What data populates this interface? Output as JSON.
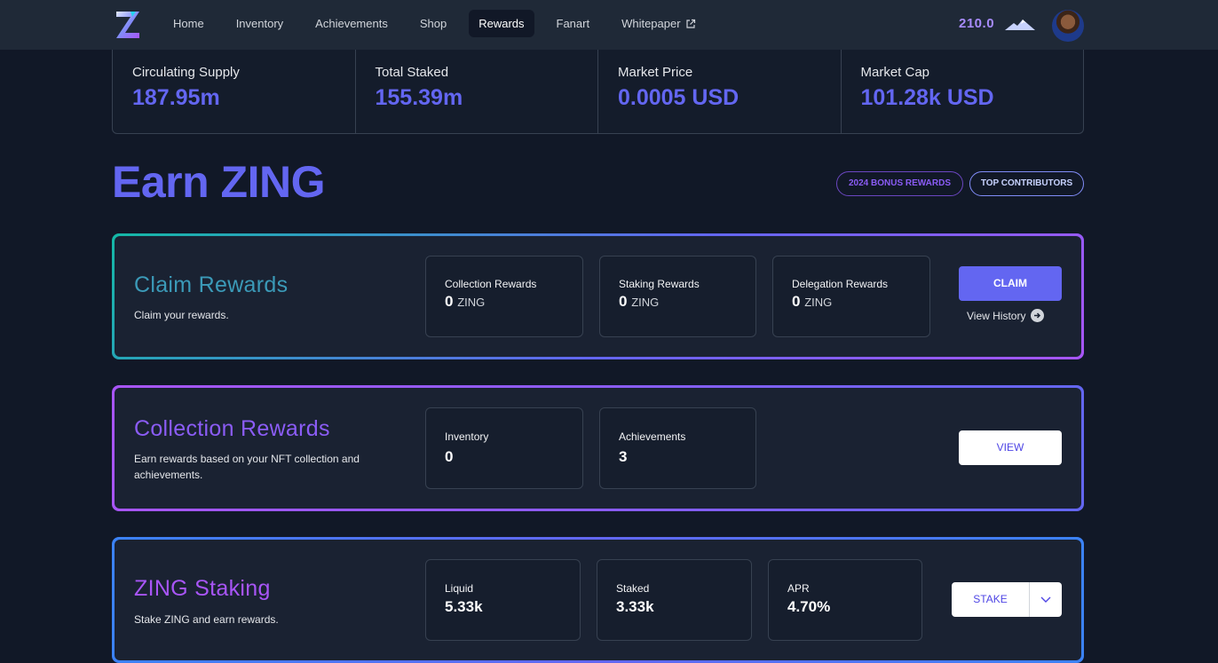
{
  "nav": {
    "links": [
      {
        "label": "Home"
      },
      {
        "label": "Inventory"
      },
      {
        "label": "Achievements"
      },
      {
        "label": "Shop"
      },
      {
        "label": "Rewards"
      },
      {
        "label": "Fanart"
      },
      {
        "label": "Whitepaper"
      }
    ],
    "active": "Rewards",
    "balance": "210.0"
  },
  "stats": [
    {
      "label": "Circulating Supply",
      "value": "187.95m"
    },
    {
      "label": "Total Staked",
      "value": "155.39m"
    },
    {
      "label": "Market Price",
      "value": "0.0005 USD"
    },
    {
      "label": "Market Cap",
      "value": "101.28k USD"
    }
  ],
  "page": {
    "title": "Earn ZING",
    "bonus_label": "2024 BONUS REWARDS",
    "top_label": "TOP CONTRIBUTORS"
  },
  "claim": {
    "title": "Claim Rewards",
    "desc": "Claim your rewards.",
    "boxes": [
      {
        "label": "Collection Rewards",
        "value": "0",
        "unit": "ZING"
      },
      {
        "label": "Staking Rewards",
        "value": "0",
        "unit": "ZING"
      },
      {
        "label": "Delegation Rewards",
        "value": "0",
        "unit": "ZING"
      }
    ],
    "button": "CLAIM",
    "history": "View History"
  },
  "collection": {
    "title": "Collection Rewards",
    "desc": "Earn rewards based on your NFT collection and achievements.",
    "boxes": [
      {
        "label": "Inventory",
        "value": "0"
      },
      {
        "label": "Achievements",
        "value": "3"
      }
    ],
    "button": "VIEW"
  },
  "staking": {
    "title": "ZING Staking",
    "desc": "Stake ZING and earn rewards.",
    "boxes": [
      {
        "label": "Liquid",
        "value": "5.33k"
      },
      {
        "label": "Staked",
        "value": "3.33k"
      },
      {
        "label": "APR",
        "value": "4.70%"
      }
    ],
    "button": "STAKE"
  },
  "colors": {
    "background": "#111827",
    "accent": "#6366f1",
    "claim_title": "#3b9ab8",
    "collection_title": "#8b5cf6",
    "staking_title": "#a855f7"
  }
}
